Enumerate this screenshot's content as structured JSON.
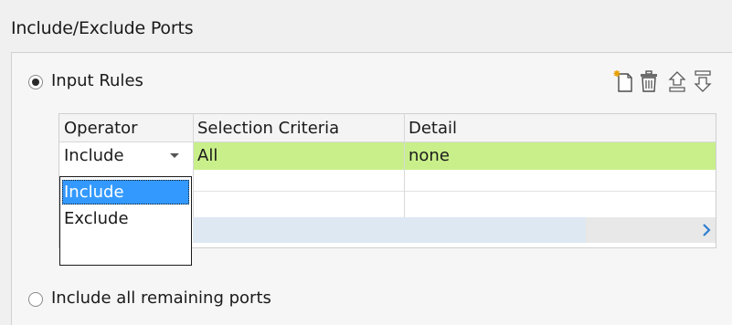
{
  "section": {
    "title": "Include/Exclude Ports"
  },
  "input_rules": {
    "label": "Input Rules",
    "checked": true
  },
  "toolbar": {
    "icons": [
      "new-row-icon",
      "delete-icon",
      "move-up-icon",
      "move-down-icon"
    ]
  },
  "table": {
    "columns": [
      "Operator",
      "Selection Criteria",
      "Detail"
    ],
    "rows": [
      {
        "operator": "Include",
        "criteria": "All",
        "detail": "none"
      }
    ],
    "selected_row_color": "#c9ef8b"
  },
  "dropdown": {
    "options": [
      "Include",
      "Exclude"
    ],
    "selected": "Include"
  },
  "remaining": {
    "label": "Include all remaining ports",
    "checked": false
  },
  "colors": {
    "selection_blue": "#3399ff",
    "scrollbar": "#dde8f3"
  }
}
